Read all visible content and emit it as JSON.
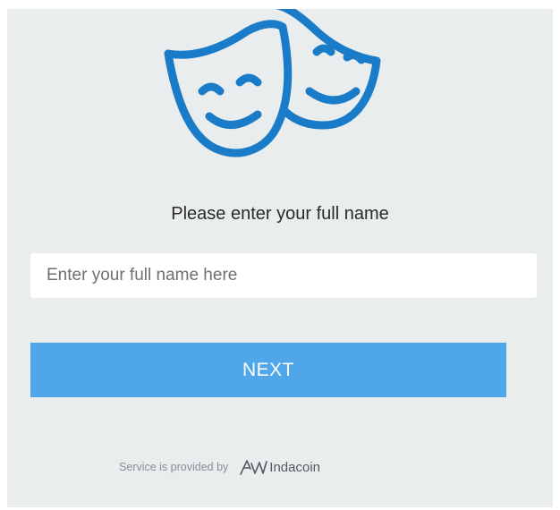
{
  "form": {
    "heading": "Please enter your full name",
    "name_placeholder": "Enter your full name here",
    "name_value": "",
    "next_label": "NEXT"
  },
  "footer": {
    "service_text": "Service is provided by",
    "brand_name": "Indacoin"
  },
  "icons": {
    "logo": "theater-masks-icon",
    "brand": "indacoin-logo-icon"
  },
  "colors": {
    "background": "#e9edee",
    "accent": "#1a7cc8",
    "button": "#4fa6e8",
    "button_text": "#ffffff"
  }
}
